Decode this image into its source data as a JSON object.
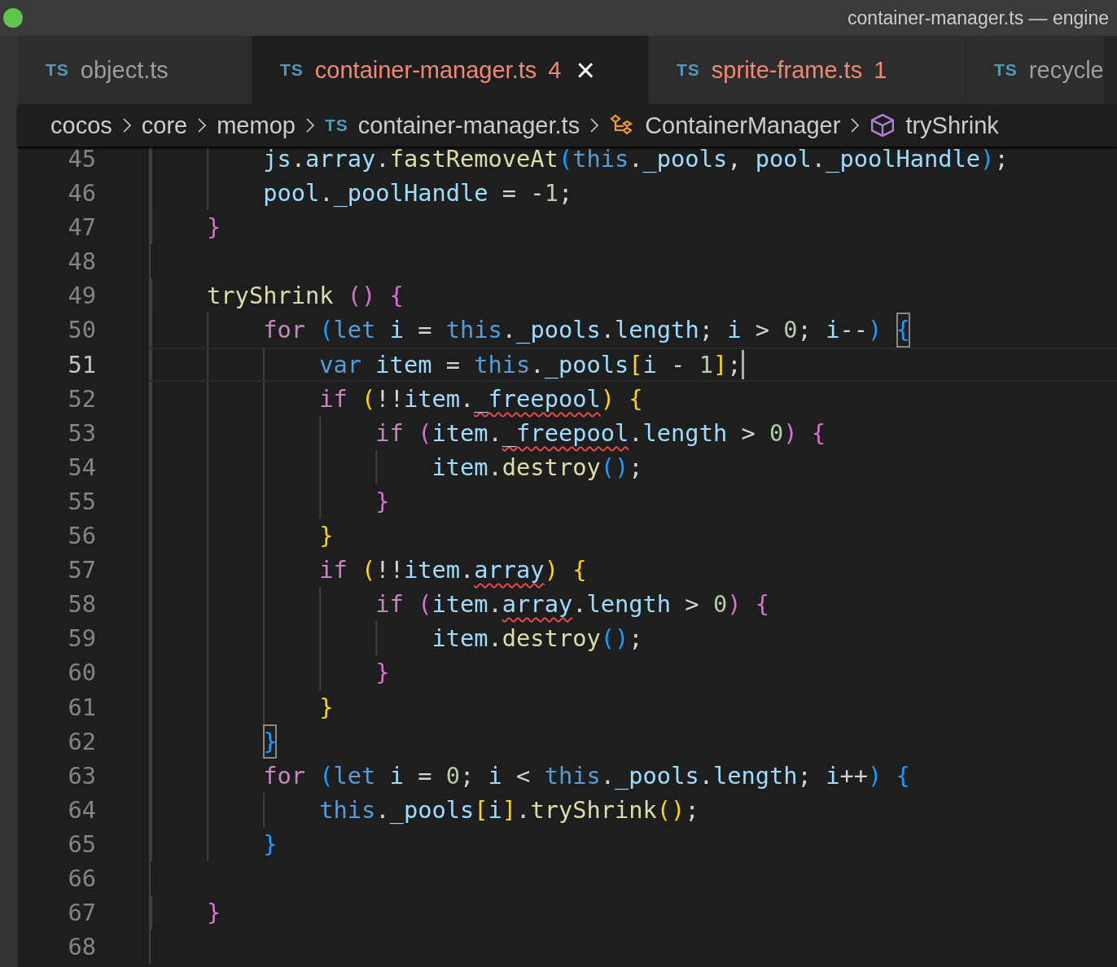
{
  "window": {
    "title": "container-manager.ts — engine"
  },
  "tabs": [
    {
      "icon_text": "TS",
      "label": "object.ts",
      "selected": false,
      "has_errors": false
    },
    {
      "icon_text": "TS",
      "label": "container-manager.ts",
      "problems": "4",
      "selected": true,
      "has_errors": true,
      "close": "×"
    },
    {
      "icon_text": "TS",
      "label": "sprite-frame.ts",
      "problems": "1",
      "selected": false,
      "has_errors": true
    },
    {
      "icon_text": "TS",
      "label": "recycle",
      "selected": false,
      "has_errors": false
    }
  ],
  "breadcrumbs": [
    {
      "kind": "folder",
      "label": "cocos"
    },
    {
      "kind": "folder",
      "label": "core"
    },
    {
      "kind": "folder",
      "label": "memop"
    },
    {
      "kind": "file",
      "icon_text": "TS",
      "label": "container-manager.ts"
    },
    {
      "kind": "class",
      "label": "ContainerManager"
    },
    {
      "kind": "method",
      "label": "tryShrink"
    }
  ],
  "lines": [
    {
      "number": "45",
      "current": false,
      "tokens": [
        {
          "text": "        js",
          "kind": "var"
        },
        {
          "text": ".",
          "kind": "p"
        },
        {
          "text": "array",
          "kind": "var"
        },
        {
          "text": ".",
          "kind": "p"
        },
        {
          "text": "fastRemoveAt",
          "kind": "fn"
        },
        {
          "text": "(",
          "kind": "b3"
        },
        {
          "text": "this",
          "kind": "st"
        },
        {
          "text": ".",
          "kind": "p"
        },
        {
          "text": "_pools",
          "kind": "var"
        },
        {
          "text": ", ",
          "kind": "p"
        },
        {
          "text": "pool",
          "kind": "var"
        },
        {
          "text": ".",
          "kind": "p"
        },
        {
          "text": "_poolHandle",
          "kind": "var"
        },
        {
          "text": ")",
          "kind": "b3"
        },
        {
          "text": ";",
          "kind": "p"
        }
      ]
    },
    {
      "number": "46",
      "current": false,
      "tokens": [
        {
          "text": "        pool",
          "kind": "var"
        },
        {
          "text": ".",
          "kind": "p"
        },
        {
          "text": "_poolHandle",
          "kind": "var"
        },
        {
          "text": " = -",
          "kind": "p"
        },
        {
          "text": "1",
          "kind": "num"
        },
        {
          "text": ";",
          "kind": "p"
        }
      ]
    },
    {
      "number": "47",
      "current": false,
      "tokens": [
        {
          "text": "    }",
          "kind": "b2"
        }
      ]
    },
    {
      "number": "48",
      "current": false
    },
    {
      "number": "49",
      "current": false,
      "tokens": [
        {
          "text": "    tryShrink ",
          "kind": "fn"
        },
        {
          "text": "() {",
          "kind": "b2"
        }
      ]
    },
    {
      "number": "50",
      "current": false,
      "tokens": [
        {
          "text": "        for ",
          "kind": "kw"
        },
        {
          "text": "(",
          "kind": "b3"
        },
        {
          "text": "let ",
          "kind": "st"
        },
        {
          "text": "i",
          "kind": "var"
        },
        {
          "text": " = ",
          "kind": "p"
        },
        {
          "text": "this",
          "kind": "st"
        },
        {
          "text": ".",
          "kind": "p"
        },
        {
          "text": "_pools",
          "kind": "var"
        },
        {
          "text": ".",
          "kind": "p"
        },
        {
          "text": "length",
          "kind": "var"
        },
        {
          "text": "; ",
          "kind": "p"
        },
        {
          "text": "i",
          "kind": "var"
        },
        {
          "text": " > ",
          "kind": "p"
        },
        {
          "text": "0",
          "kind": "num"
        },
        {
          "text": "; ",
          "kind": "p"
        },
        {
          "text": "i",
          "kind": "var"
        },
        {
          "text": "--",
          "kind": "p"
        },
        {
          "text": ") ",
          "kind": "b3"
        },
        {
          "text": "{",
          "kind": "b3",
          "matched": true
        }
      ]
    },
    {
      "number": "51",
      "current": true,
      "tokens": [
        {
          "text": "            var ",
          "kind": "st"
        },
        {
          "text": "item",
          "kind": "var"
        },
        {
          "text": " = ",
          "kind": "p"
        },
        {
          "text": "this",
          "kind": "st"
        },
        {
          "text": ".",
          "kind": "p"
        },
        {
          "text": "_pools",
          "kind": "var"
        },
        {
          "text": "[",
          "kind": "b1"
        },
        {
          "text": "i",
          "kind": "var"
        },
        {
          "text": " - ",
          "kind": "p"
        },
        {
          "text": "1",
          "kind": "num"
        },
        {
          "text": "]",
          "kind": "b1"
        },
        {
          "text": ";",
          "kind": "p"
        }
      ]
    },
    {
      "number": "52",
      "current": false,
      "tokens": [
        {
          "text": "            if ",
          "kind": "kw"
        },
        {
          "text": "(",
          "kind": "b1"
        },
        {
          "text": "!!",
          "kind": "p"
        },
        {
          "text": "item",
          "kind": "var"
        },
        {
          "text": ".",
          "kind": "p"
        },
        {
          "text": "_freepool",
          "kind": "var",
          "error": true
        },
        {
          "text": ") {",
          "kind": "b1"
        }
      ]
    },
    {
      "number": "53",
      "current": false,
      "tokens": [
        {
          "text": "                if ",
          "kind": "kw"
        },
        {
          "text": "(",
          "kind": "b2"
        },
        {
          "text": "item",
          "kind": "var"
        },
        {
          "text": ".",
          "kind": "p"
        },
        {
          "text": "_freepool",
          "kind": "var",
          "error": true
        },
        {
          "text": ".",
          "kind": "p"
        },
        {
          "text": "length",
          "kind": "var"
        },
        {
          "text": " > ",
          "kind": "p"
        },
        {
          "text": "0",
          "kind": "num"
        },
        {
          "text": ") {",
          "kind": "b2"
        }
      ]
    },
    {
      "number": "54",
      "current": false,
      "tokens": [
        {
          "text": "                    item",
          "kind": "var"
        },
        {
          "text": ".",
          "kind": "p"
        },
        {
          "text": "destroy",
          "kind": "fn"
        },
        {
          "text": "()",
          "kind": "b3"
        },
        {
          "text": ";",
          "kind": "p"
        }
      ]
    },
    {
      "number": "55",
      "current": false,
      "tokens": [
        {
          "text": "                }",
          "kind": "b2"
        }
      ]
    },
    {
      "number": "56",
      "current": false,
      "tokens": [
        {
          "text": "            }",
          "kind": "b1"
        }
      ]
    },
    {
      "number": "57",
      "current": false,
      "tokens": [
        {
          "text": "            if ",
          "kind": "kw"
        },
        {
          "text": "(",
          "kind": "b1"
        },
        {
          "text": "!!",
          "kind": "p"
        },
        {
          "text": "item",
          "kind": "var"
        },
        {
          "text": ".",
          "kind": "p"
        },
        {
          "text": "array",
          "kind": "var",
          "error": true
        },
        {
          "text": ") {",
          "kind": "b1"
        }
      ]
    },
    {
      "number": "58",
      "current": false,
      "tokens": [
        {
          "text": "                if ",
          "kind": "kw"
        },
        {
          "text": "(",
          "kind": "b2"
        },
        {
          "text": "item",
          "kind": "var"
        },
        {
          "text": ".",
          "kind": "p"
        },
        {
          "text": "array",
          "kind": "var",
          "error": true
        },
        {
          "text": ".",
          "kind": "p"
        },
        {
          "text": "length",
          "kind": "var"
        },
        {
          "text": " > ",
          "kind": "p"
        },
        {
          "text": "0",
          "kind": "num"
        },
        {
          "text": ") {",
          "kind": "b2"
        }
      ]
    },
    {
      "number": "59",
      "current": false,
      "tokens": [
        {
          "text": "                    item",
          "kind": "var"
        },
        {
          "text": ".",
          "kind": "p"
        },
        {
          "text": "destroy",
          "kind": "fn"
        },
        {
          "text": "()",
          "kind": "b3"
        },
        {
          "text": ";",
          "kind": "p"
        }
      ]
    },
    {
      "number": "60",
      "current": false,
      "tokens": [
        {
          "text": "                }",
          "kind": "b2"
        }
      ]
    },
    {
      "number": "61",
      "current": false,
      "tokens": [
        {
          "text": "            }",
          "kind": "b1"
        }
      ]
    },
    {
      "number": "62",
      "current": false,
      "tokens": [
        {
          "text": "        }",
          "kind": "b3",
          "matched": true
        }
      ]
    },
    {
      "number": "63",
      "current": false,
      "tokens": [
        {
          "text": "        for ",
          "kind": "kw"
        },
        {
          "text": "(",
          "kind": "b3"
        },
        {
          "text": "let ",
          "kind": "st"
        },
        {
          "text": "i",
          "kind": "var"
        },
        {
          "text": " = ",
          "kind": "p"
        },
        {
          "text": "0",
          "kind": "num"
        },
        {
          "text": "; ",
          "kind": "p"
        },
        {
          "text": "i",
          "kind": "var"
        },
        {
          "text": " < ",
          "kind": "p"
        },
        {
          "text": "this",
          "kind": "st"
        },
        {
          "text": ".",
          "kind": "p"
        },
        {
          "text": "_pools",
          "kind": "var"
        },
        {
          "text": ".",
          "kind": "p"
        },
        {
          "text": "length",
          "kind": "var"
        },
        {
          "text": "; ",
          "kind": "p"
        },
        {
          "text": "i",
          "kind": "var"
        },
        {
          "text": "++",
          "kind": "p"
        },
        {
          "text": ") {",
          "kind": "b3"
        }
      ]
    },
    {
      "number": "64",
      "current": false,
      "tokens": [
        {
          "text": "            this",
          "kind": "st"
        },
        {
          "text": ".",
          "kind": "p"
        },
        {
          "text": "_pools",
          "kind": "var"
        },
        {
          "text": "[",
          "kind": "b1"
        },
        {
          "text": "i",
          "kind": "var"
        },
        {
          "text": "]",
          "kind": "b1"
        },
        {
          "text": ".",
          "kind": "p"
        },
        {
          "text": "tryShrink",
          "kind": "fn"
        },
        {
          "text": "()",
          "kind": "b1"
        },
        {
          "text": ";",
          "kind": "p"
        }
      ]
    },
    {
      "number": "65",
      "current": false,
      "tokens": [
        {
          "text": "        }",
          "kind": "b3"
        }
      ]
    },
    {
      "number": "66",
      "current": false
    },
    {
      "number": "67",
      "current": false,
      "tokens": [
        {
          "text": "    }",
          "kind": "b2"
        }
      ]
    },
    {
      "number": "68",
      "current": false
    }
  ]
}
